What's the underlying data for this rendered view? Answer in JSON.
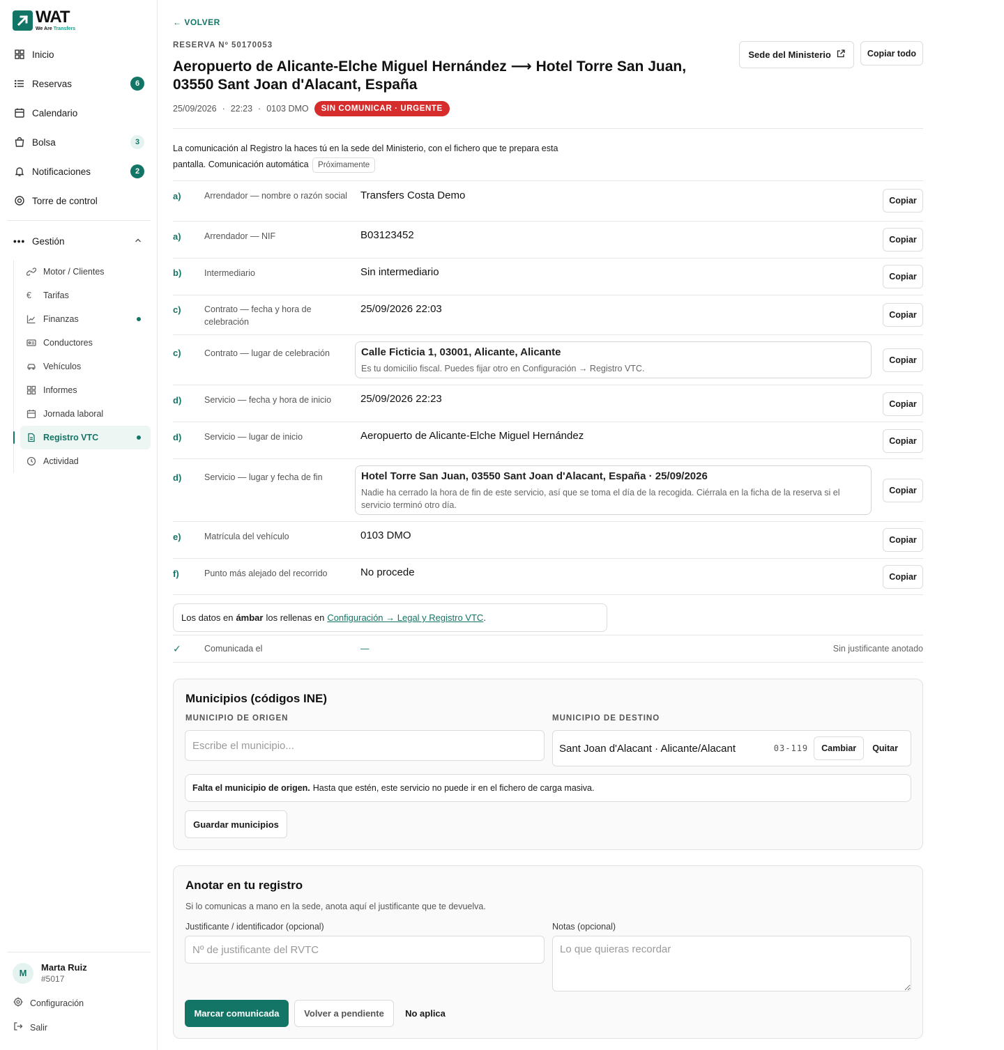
{
  "brand": {
    "word": "WAT",
    "tag_a": "We Are",
    "tag_b": "Transfers"
  },
  "nav": {
    "items": [
      {
        "label": "Inicio"
      },
      {
        "label": "Reservas",
        "badge": "6"
      },
      {
        "label": "Calendario"
      },
      {
        "label": "Bolsa",
        "badge": "3"
      },
      {
        "label": "Notificaciones",
        "badge": "2"
      },
      {
        "label": "Torre de control"
      }
    ],
    "group": {
      "label": "Gestión",
      "items": [
        {
          "label": "Motor / Clientes"
        },
        {
          "label": "Tarifas"
        },
        {
          "label": "Finanzas"
        },
        {
          "label": "Conductores"
        },
        {
          "label": "Vehículos"
        },
        {
          "label": "Informes"
        },
        {
          "label": "Jornada laboral"
        },
        {
          "label": "Registro VTC"
        },
        {
          "label": "Actividad"
        }
      ]
    }
  },
  "user": {
    "initial": "M",
    "name": "Marta Ruiz",
    "id": "#5017"
  },
  "footer": {
    "settings": "Configuración",
    "logout": "Salir"
  },
  "header": {
    "back": "VOLVER",
    "reservation": "RESERVA Nº 50170053",
    "title": "Aeropuerto de Alicante-Elche Miguel Hernández ⟶ Hotel Torre San Juan, 03550 Sant Joan d'Alacant, España",
    "date": "25/09/2026",
    "time": "22:23",
    "plate": "0103 DMO",
    "status": "SIN COMUNICAR · URGENTE",
    "sede_button": "Sede del Ministerio",
    "copy_all_button": "Copiar todo"
  },
  "intro": {
    "text": "La comunicación al Registro la haces tú en la sede del Ministerio, con el fichero que te prepara esta pantalla. Comunicación automática",
    "soon": "Próximamente"
  },
  "copy_label": "Copiar",
  "fields": [
    {
      "letter": "a)",
      "label": "Arrendador — nombre o razón social",
      "value": "Transfers Costa Demo"
    },
    {
      "letter": "a)",
      "label": "Arrendador — NIF",
      "value": "B03123452"
    },
    {
      "letter": "b)",
      "label": "Intermediario",
      "value": "Sin intermediario"
    },
    {
      "letter": "c)",
      "label": "Contrato — fecha y hora de celebración",
      "value": "25/09/2026 22:03"
    },
    {
      "letter": "c)",
      "label": "Contrato — lugar de celebración",
      "value": "Calle Ficticia 1, 03001, Alicante, Alicante",
      "note": "Es tu domicilio fiscal. Puedes fijar otro en Configuración → Registro VTC."
    },
    {
      "letter": "d)",
      "label": "Servicio — fecha y hora de inicio",
      "value": "25/09/2026 22:23"
    },
    {
      "letter": "d)",
      "label": "Servicio — lugar de inicio",
      "value": "Aeropuerto de Alicante-Elche Miguel Hernández"
    },
    {
      "letter": "d)",
      "label": "Servicio — lugar y fecha de fin",
      "value": "Hotel Torre San Juan, 03550 Sant Joan d'Alacant, España · 25/09/2026",
      "note": "Nadie ha cerrado la hora de fin de este servicio, así que se toma el día de la recogida. Ciérrala en la ficha de la reserva si el servicio terminó otro día."
    },
    {
      "letter": "e)",
      "label": "Matrícula del vehículo",
      "value": "0103 DMO"
    },
    {
      "letter": "f)",
      "label": "Punto más alejado del recorrido",
      "value": "No procede"
    }
  ],
  "legend": {
    "before": "Los datos en",
    "bold": "ámbar",
    "middle": "los rellenas en",
    "link": "Configuración → Legal y Registro VTC",
    "after": "."
  },
  "communicated": {
    "check": "✓",
    "label": "Comunicada el",
    "value": "—",
    "right": "Sin justificante anotado"
  },
  "municipios": {
    "title": "Municipios (códigos INE)",
    "origin_label": "MUNICIPIO DE ORIGEN",
    "origin_placeholder": "Escribe el municipio...",
    "dest_label": "MUNICIPIO DE DESTINO",
    "dest_value": "Sant Joan d'Alacant · Alicante/Alacant",
    "dest_code": "03-119",
    "change": "Cambiar",
    "remove": "Quitar",
    "warning_bold": "Falta el municipio de origen.",
    "warning_text": "Hasta que estén, este servicio no puede ir en el fichero de carga masiva.",
    "save": "Guardar municipios"
  },
  "anotar": {
    "title": "Anotar en tu registro",
    "hint": "Si lo comunicas a mano en la sede, anota aquí el justificante que te devuelva.",
    "receipt_label": "Justificante / identificador (opcional)",
    "receipt_placeholder": "Nº de justificante del RVTC",
    "notes_label": "Notas (opcional)",
    "notes_placeholder": "Lo que quieras recordar",
    "mark": "Marcar comunicada",
    "revert": "Volver a pendiente",
    "na": "No aplica"
  }
}
